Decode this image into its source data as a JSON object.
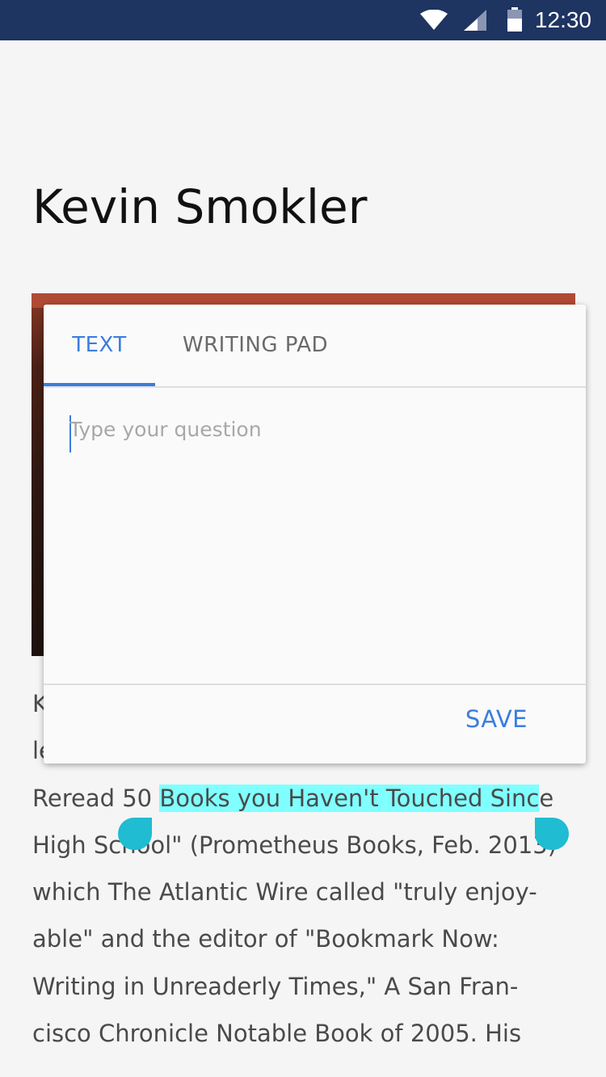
{
  "status_bar": {
    "time": "12:30"
  },
  "page": {
    "title": "Kevin Smokler"
  },
  "bio": {
    "line1": "K",
    "line2": "le",
    "line3_before": "Reread 50 ",
    "line3_highlight": "Books you Haven't Touched Sinc",
    "line3_after": "e",
    "line4": "High School\" (Prometheus Books, Feb. 2013)",
    "line5": "which The Atlantic Wire called \"truly enjoy-",
    "line6": "able\" and the editor of \"Bookmark Now:",
    "line7": "Writing in Unreaderly Times,\" A San Fran-",
    "line8": "cisco Chronicle Notable Book of 2005. His"
  },
  "dialog": {
    "tabs": [
      {
        "label": "TEXT"
      },
      {
        "label": "WRITING PAD"
      }
    ],
    "input_placeholder": "Type your question",
    "save_label": "SAVE"
  },
  "colors": {
    "status_bar": "#1e3461",
    "accent": "#3a7de0",
    "selection": "#80ffff",
    "handle": "#1fbcd2"
  }
}
